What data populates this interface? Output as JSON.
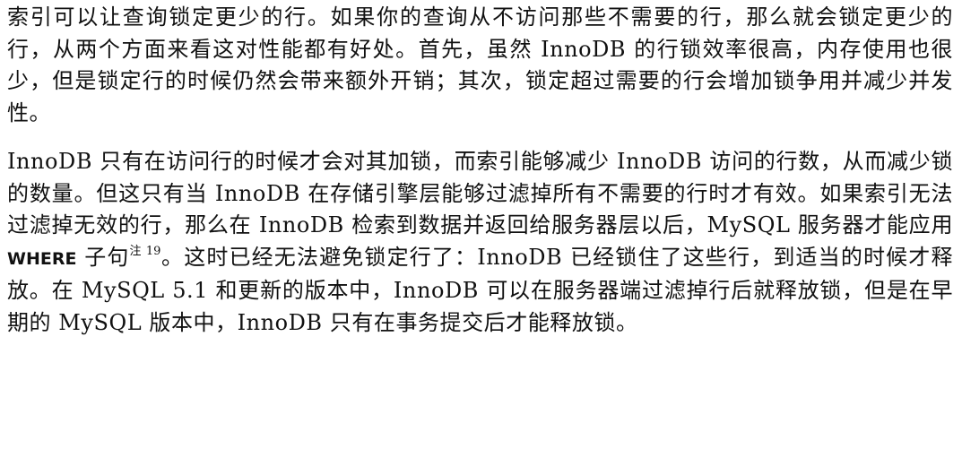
{
  "paragraphs": {
    "first": "索引可以让查询锁定更少的行。如果你的查询从不访问那些不需要的行，那么就会锁定更少的行，从两个方面来看这对性能都有好处。首先，虽然 InnoDB 的行锁效率很高，内存使用也很少，但是锁定行的时候仍然会带来额外开销；其次，锁定超过需要的行会增加锁争用并减少并发性。",
    "second": {
      "part1": "InnoDB 只有在访问行的时候才会对其加锁，而索引能够减少 InnoDB 访问的行数，从而减少锁的数量。但这只有当 InnoDB 在存储引擎层能够过滤掉所有不需要的行时才有效。如果索引无法过滤掉无效的行，那么在 InnoDB 检索到数据并返回给服务器层以后，MySQL 服务器才能应用 ",
      "code_keyword": "WHERE",
      "part2": " 子句",
      "note_ref": "注 19",
      "part3": "。这时已经无法避免锁定行了：InnoDB 已经锁住了这些行，到适当的时候才释放。在 MySQL 5.1 和更新的版本中，InnoDB 可以在服务器端过滤掉行后就释放锁，但是在早期的 MySQL 版本中，InnoDB 只有在事务提交后才能释放锁。"
    }
  }
}
